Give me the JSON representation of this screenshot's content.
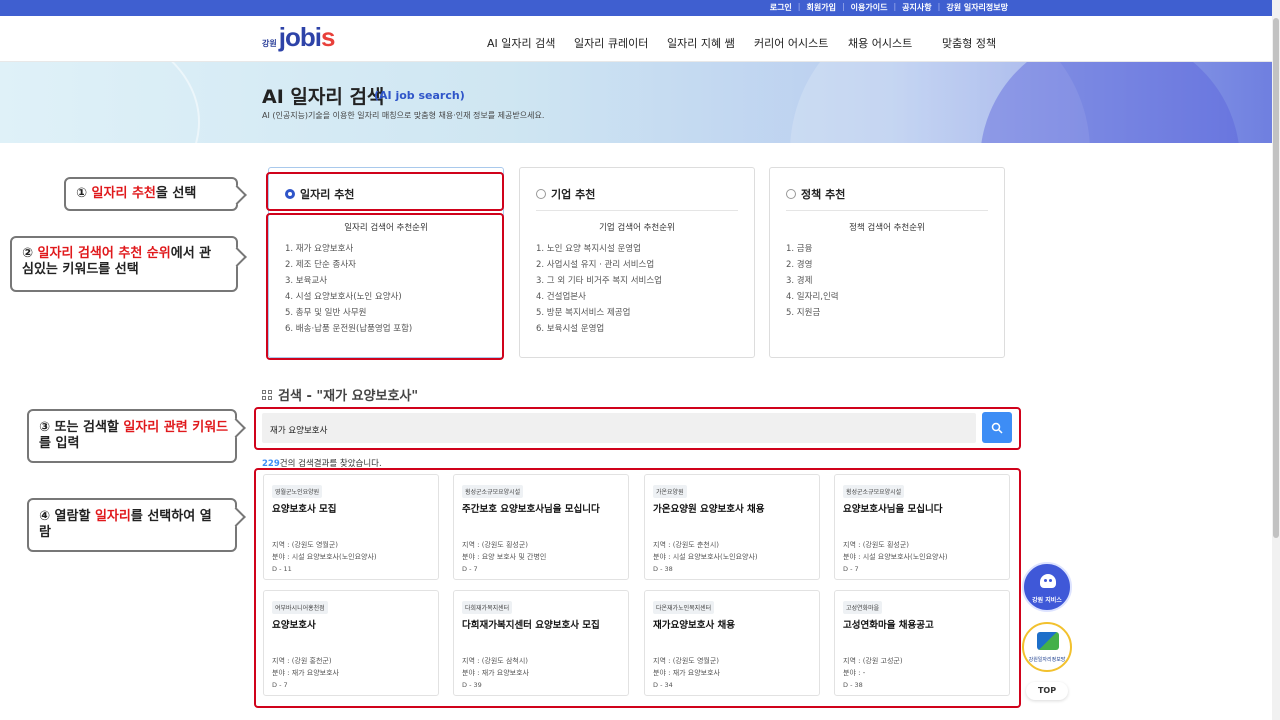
{
  "util_links": [
    "로그인",
    "회원가입",
    "이용가이드",
    "공지사항",
    "강원 일자리정보망"
  ],
  "logo": {
    "region": "강원",
    "name_a": "jobi",
    "name_b": "s"
  },
  "nav": [
    "AI 일자리 검색",
    "일자리 큐레이터",
    "일자리 지혜 쌤",
    "커리어 어시스트",
    "채용 어시스트",
    "맞춤형 정책"
  ],
  "hero": {
    "title": "AI 일자리 검색",
    "subtitle": "(AI job search)",
    "description": "AI (인공지능)기술을 이용한 일자리 매칭으로 맞춤형 채용·인재 정보를 제공받으세요."
  },
  "panels": [
    {
      "label": "일자리 추천",
      "selected": true,
      "subtitle": "일자리 검색어 추천순위",
      "items": [
        "1. 재가 요양보호사",
        "2. 제조 단순 종사자",
        "3. 보육교사",
        "4. 시설 요양보호사(노인 요양사)",
        "5. 총무 및 일반 사무원",
        "6. 배송·납품 운전원(납품영업 포함)"
      ]
    },
    {
      "label": "기업 추천",
      "selected": false,
      "subtitle": "기업 검색어 추천순위",
      "items": [
        "1. 노인 요양 복지시설 운영업",
        "2. 사업시설 유지 · 관리 서비스업",
        "3. 그 외 기타 비거주 복지 서비스업",
        "4. 건설업본사",
        "5. 방문 복지서비스 제공업",
        "6. 보육시설 운영업"
      ]
    },
    {
      "label": "정책 추천",
      "selected": false,
      "subtitle": "정책 검색어 추천순위",
      "items": [
        "1. 금융",
        "2. 경영",
        "3. 경제",
        "4. 일자리,인력",
        "5. 지원금"
      ]
    }
  ],
  "callouts": {
    "c1": {
      "pre": "① ",
      "red": "일자리 추천",
      "post": "을  선택"
    },
    "c2": {
      "pre": "② ",
      "red": "일자리 검색어 추천 순위",
      "post": "에서 관심있는 키워드를 선택"
    },
    "c3": {
      "pre": "③ 또는 검색할 ",
      "red": "일자리 관련 키워드",
      "post": "를 입력"
    },
    "c4": {
      "pre": "④ 열람할 ",
      "red": "일자리",
      "post": "를 선택하여 열람"
    }
  },
  "search": {
    "title": "검색 - \"재가 요양보호사\"",
    "value": "재가 요양보호사",
    "count": "229",
    "count_suffix": "건의 검색결과를 찾았습니다."
  },
  "cards": [
    {
      "org": "영월군노인요양원",
      "title": "요양보호사 모집",
      "region": "지역 : (강원도 영월군)",
      "field": "분야 : 시설 요양보호사(노인요양사)",
      "dday": "D - 11"
    },
    {
      "org": "횡성군소규모요양시설",
      "title": "주간보호 요양보호사님을 모십니다",
      "region": "지역 : (강원도 횡성군)",
      "field": "분야 : 요양 보호사 및 간병인",
      "dday": "D - 7"
    },
    {
      "org": "가온요양원",
      "title": "가온요양원 요양보호사 채용",
      "region": "지역 : (강원도 춘천시)",
      "field": "분야 : 시설 요양보호사(노인요양사)",
      "dday": "D - 38"
    },
    {
      "org": "횡성군소규모요양시설",
      "title": "요양보호사님을 모십니다",
      "region": "지역 : (강원도 횡성군)",
      "field": "분야 : 시설 요양보호사(노인요양사)",
      "dday": "D - 7"
    },
    {
      "org": "여부바시니어홍천점",
      "title": "요양보호사",
      "region": "지역 : (강원 홍천군)",
      "field": "분야 : 재가 요양보호사",
      "dday": "D - 7"
    },
    {
      "org": "다희재가복지센터",
      "title": "다희재가복지센터 요양보호사 모집",
      "region": "지역 : (강원도 삼척시)",
      "field": "분야 : 재가 요양보호사",
      "dday": "D - 39"
    },
    {
      "org": "다온재가노인복지센터",
      "title": "재가요양보호사 채용",
      "region": "지역 : (강원도 영월군)",
      "field": "분야 : 재가 요양보호사",
      "dday": "D - 34"
    },
    {
      "org": "고성연화마을",
      "title": "고성연화마을 채용공고",
      "region": "지역 : (강원 고성군)",
      "field": "분야 : -",
      "dday": "D - 38"
    }
  ],
  "fabs": {
    "bot_label": "강원 지비스",
    "gw_label": "강원일자리정보망",
    "top": "TOP"
  },
  "colors": {
    "accent": "#3f5fd0",
    "highlight": "#d0021b",
    "search_button": "#3d8df5"
  }
}
